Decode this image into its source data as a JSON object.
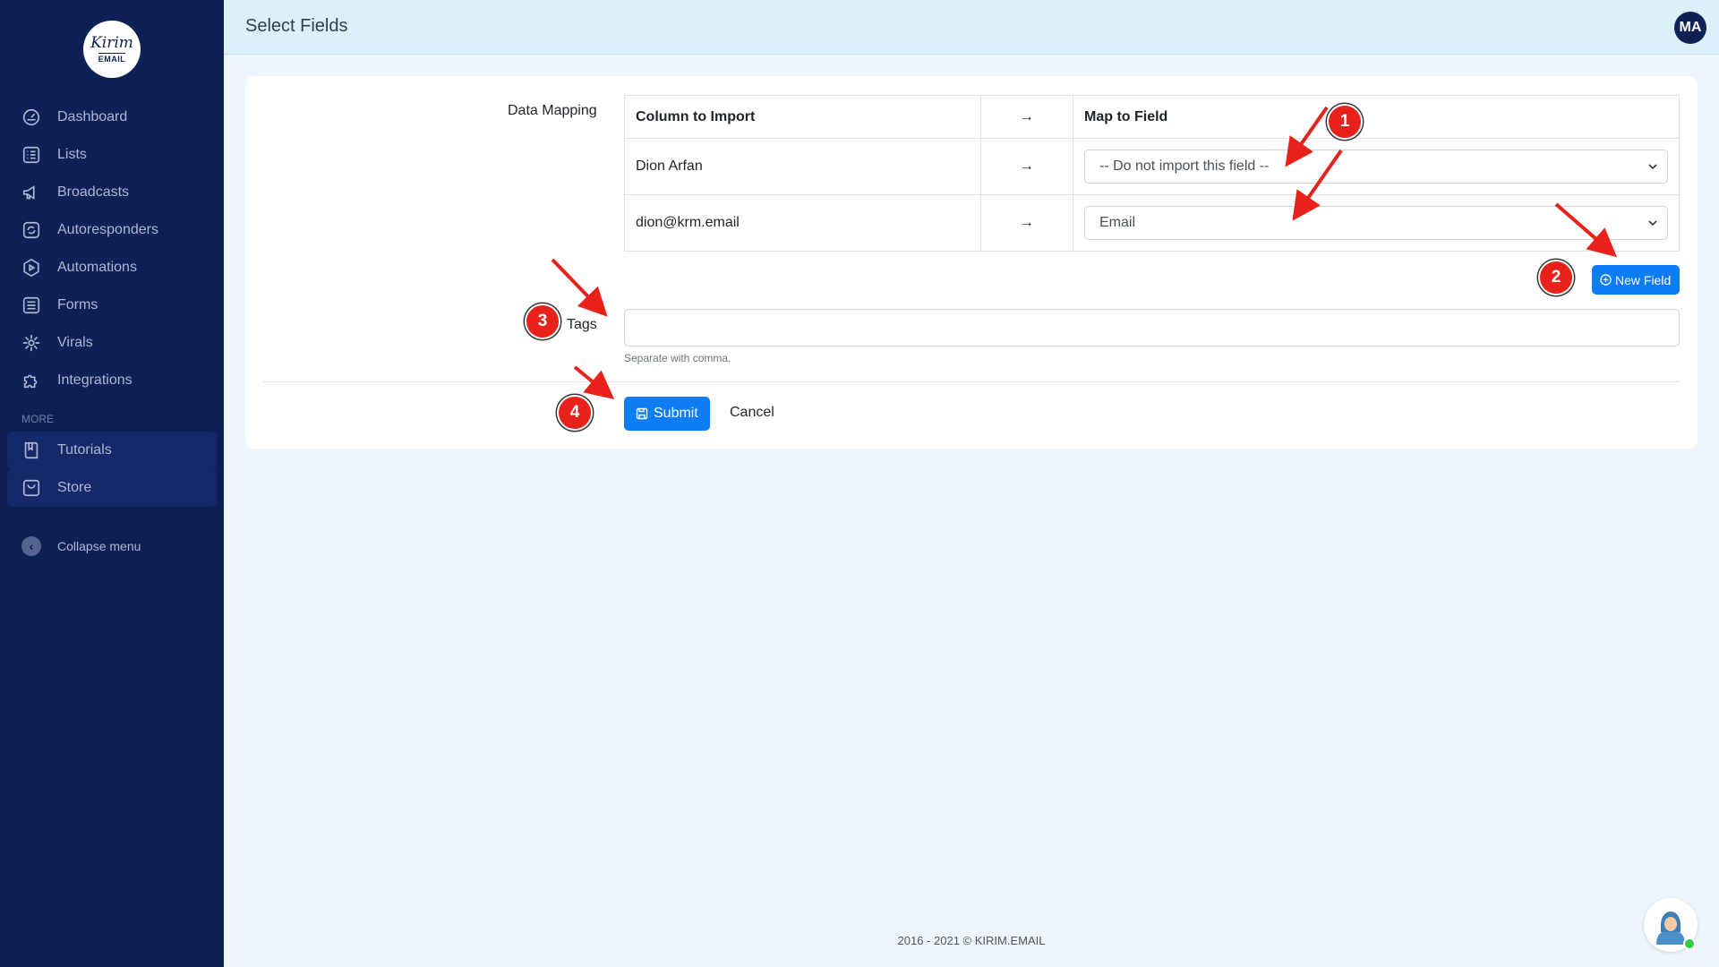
{
  "logo": {
    "brand_script": "Kirim",
    "brand_sub": "EMAIL"
  },
  "header": {
    "title": "Select Fields",
    "avatar_initials": "MA"
  },
  "sidebar": {
    "items": [
      {
        "label": "Dashboard",
        "icon": "dashboard-icon"
      },
      {
        "label": "Lists",
        "icon": "list-icon"
      },
      {
        "label": "Broadcasts",
        "icon": "megaphone-icon"
      },
      {
        "label": "Autoresponders",
        "icon": "refresh-icon"
      },
      {
        "label": "Automations",
        "icon": "play-gear-icon"
      },
      {
        "label": "Forms",
        "icon": "form-icon"
      },
      {
        "label": "Virals",
        "icon": "viral-icon"
      },
      {
        "label": "Integrations",
        "icon": "puzzle-icon"
      }
    ],
    "section_more": "MORE",
    "more_items": [
      {
        "label": "Tutorials",
        "icon": "book-icon"
      },
      {
        "label": "Store",
        "icon": "store-icon"
      }
    ],
    "collapse_label": "Collapse menu"
  },
  "form": {
    "data_mapping_label": "Data Mapping",
    "table": {
      "headers": [
        "Column to Import",
        "→",
        "Map to Field"
      ],
      "rows": [
        {
          "column": "Dion Arfan",
          "arrow": "→",
          "field": "-- Do not import this field --"
        },
        {
          "column": "dion@krm.email",
          "arrow": "→",
          "field": "Email"
        }
      ]
    },
    "new_field_label": "New Field",
    "tags_label": "Tags",
    "tags_value": "",
    "tags_hint": "Separate with comma.",
    "submit_label": "Submit",
    "cancel_label": "Cancel"
  },
  "annotations": [
    "1",
    "2",
    "3",
    "4"
  ],
  "colors": {
    "sidebar_bg": "#0e2157",
    "primary": "#0d7df3",
    "annotation": "#e8221b",
    "header_bg": "#daf1fa"
  },
  "footer": {
    "text": "2016 - 2021 © KIRIM.EMAIL"
  }
}
